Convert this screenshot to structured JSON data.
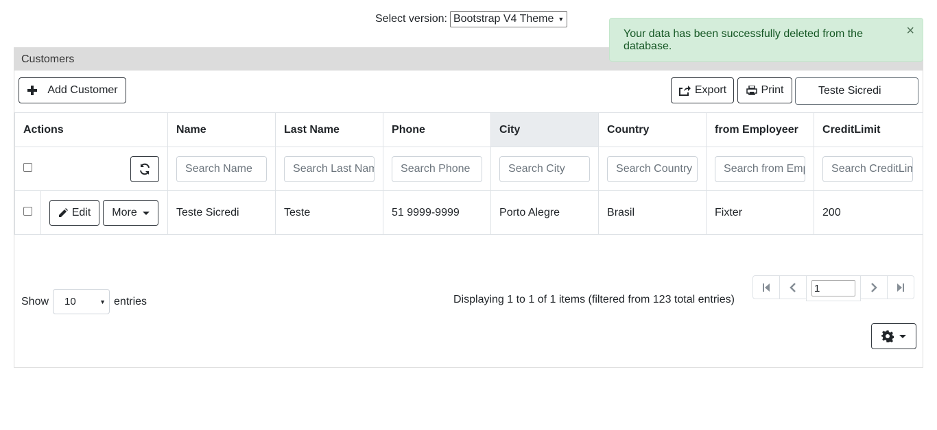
{
  "version": {
    "label": "Select version:",
    "selected": "Bootstrap V4 Theme"
  },
  "alert": {
    "message": "Your data has been successfully deleted from the database.",
    "close": "×"
  },
  "panel": {
    "title": "Customers"
  },
  "toolbar": {
    "add_label": "Add Customer",
    "export_label": "Export",
    "print_label": "Print",
    "quick_search_value": "Teste Sicredi"
  },
  "table": {
    "columns": [
      "Actions",
      "Name",
      "Last Name",
      "Phone",
      "City",
      "Country",
      "from Employeer",
      "CreditLimit"
    ],
    "sorted_column": "City",
    "filter_placeholders": [
      "Search Name",
      "Search Last Name",
      "Search Phone",
      "Search City",
      "Search Country",
      "Search from Employeer",
      "Search CreditLimit"
    ],
    "rows": [
      {
        "edit_label": "Edit",
        "more_label": "More",
        "cells": [
          "Teste Sicredi",
          "Teste",
          "51 9999-9999",
          "Porto Alegre",
          "Brasil",
          "Fixter",
          "200"
        ]
      }
    ]
  },
  "footer": {
    "show_label": "Show",
    "page_size": "10",
    "entries_label": "entries",
    "display_info": "Displaying 1 to 1 of 1 items (filtered from 123 total entries)",
    "current_page": "1"
  },
  "colors": {
    "alert_bg": "#d4edda",
    "alert_text": "#155724",
    "header_bg": "#dcdcdc",
    "sorted_bg": "#e9ecef"
  }
}
